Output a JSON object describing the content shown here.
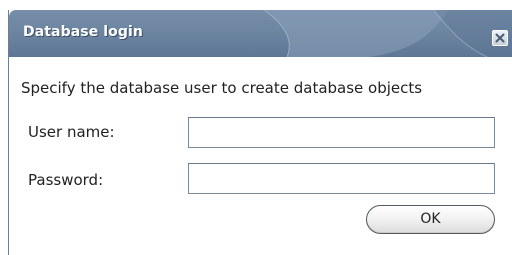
{
  "window": {
    "title": "Database login",
    "close_icon": "close-icon"
  },
  "main": {
    "instruction": "Specify the database user to create database objects",
    "user_name": {
      "label": "User name:",
      "value": ""
    },
    "password": {
      "label": "Password:",
      "value": ""
    },
    "ok_label": "OK"
  },
  "colors": {
    "titlebar": "#6a839f",
    "titlebar_text": "#ffffff",
    "body": "#ffffff",
    "text": "#222222",
    "field_border": "#7a8a99"
  }
}
